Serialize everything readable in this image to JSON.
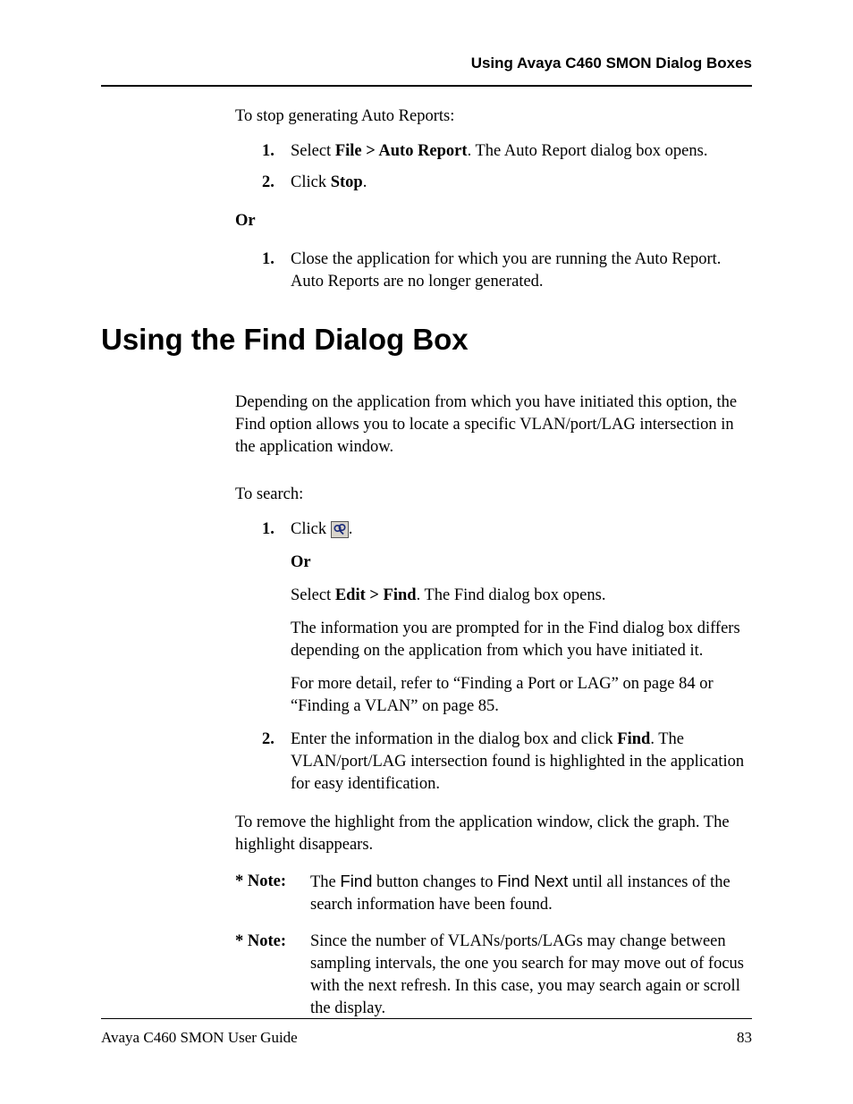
{
  "header": {
    "running": "Using Avaya C460 SMON Dialog Boxes"
  },
  "intro": {
    "stop_generating": "To stop generating Auto Reports:",
    "step1_a": "Select ",
    "step1_b": "File > Auto Report",
    "step1_c": ". The Auto Report dialog box opens.",
    "step2_a": "Click ",
    "step2_b": "Stop",
    "step2_c": ".",
    "or": "Or",
    "alt1": "Close the application for which you are running the Auto Report. Auto Reports are no longer generated."
  },
  "section_title": "Using the Find Dialog Box",
  "find": {
    "para1": "Depending on the application from which you have initiated this option, the Find option allows you to locate a specific VLAN/port/LAG intersection in the application window.",
    "to_search": "To search:",
    "s1_click": "Click ",
    "s1_period": ".",
    "or": "Or",
    "s1_alt_a": "Select ",
    "s1_alt_b": "Edit > Find",
    "s1_alt_c": ". The Find dialog box opens.",
    "s1_p2": "The information you are prompted for in the Find dialog box differs depending on the application from which you have initiated it.",
    "s1_p3": "For more detail, refer to “Finding a Port or LAG” on page 84 or “Finding a VLAN” on page 85.",
    "s2_a": "Enter the information in the dialog box and click ",
    "s2_b": "Find",
    "s2_c": ". The VLAN/port/LAG intersection found is highlighted in the application for easy identification.",
    "remove": "To remove the highlight from the application window, click the graph. The highlight disappears."
  },
  "notes": {
    "label": "* Note:",
    "n1_a": "The ",
    "n1_b": "Find",
    "n1_c": " button changes to ",
    "n1_d": "Find Next",
    "n1_e": " until all instances of the search information have been found.",
    "n2": "Since the number of VLANs/ports/LAGs may change between sampling intervals, the one you search for may move out of focus with the next refresh. In this case, you may search again or scroll the display."
  },
  "footer": {
    "guide": "Avaya C460 SMON User Guide",
    "page": "83"
  },
  "numbers": {
    "one": "1.",
    "two": "2."
  }
}
